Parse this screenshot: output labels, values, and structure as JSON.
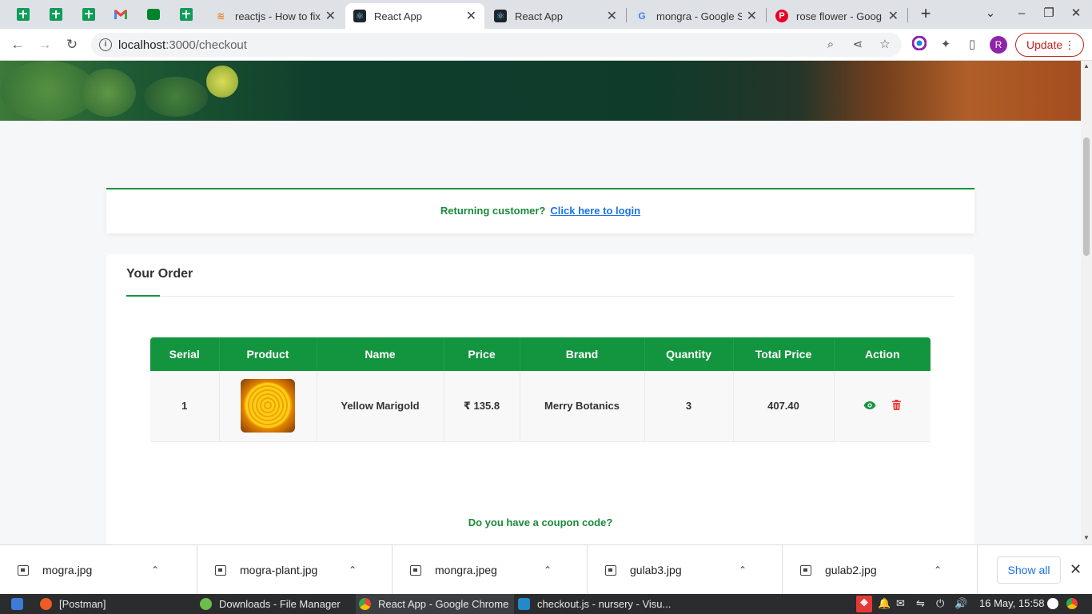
{
  "browser": {
    "tabs": [
      {
        "label": "reactjs - How to fix",
        "icon": "stackoverflow-icon"
      },
      {
        "label": "React App",
        "icon": "react-icon",
        "active": true
      },
      {
        "label": "React App",
        "icon": "react-icon"
      },
      {
        "label": "mongra - Google S",
        "icon": "google-icon"
      },
      {
        "label": "rose flower - Goog",
        "icon": "pinterest-icon"
      }
    ],
    "url_host": "localhost",
    "url_path": ":3000/checkout",
    "profile_initial": "R",
    "update_label": "Update"
  },
  "page": {
    "login_prompt": "Returning customer?",
    "login_link": "Click here to login",
    "order_title": "Your Order",
    "table": {
      "headers": [
        "Serial",
        "Product",
        "Name",
        "Price",
        "Brand",
        "Quantity",
        "Total Price",
        "Action"
      ],
      "rows": [
        {
          "serial": "1",
          "name": "Yellow Marigold",
          "price": "₹ 135.8",
          "brand": "Merry Botanics",
          "quantity": "3",
          "total": "407.40"
        }
      ]
    },
    "coupon_prompt": "Do you have a coupon code?"
  },
  "downloads": {
    "files": [
      "mogra.jpg",
      "mogra-plant.jpg",
      "mongra.jpeg",
      "gulab3.jpg",
      "gulab2.jpg"
    ],
    "show_all": "Show all"
  },
  "taskbar": {
    "apps": [
      "[Postman]",
      "Downloads - File Manager",
      "React App - Google Chrome",
      "checkout.js - nursery - Visu..."
    ],
    "clock": "16 May, 15:58"
  },
  "colors": {
    "accent": "#13953f",
    "link": "#1a73e8",
    "danger": "#e53935"
  }
}
